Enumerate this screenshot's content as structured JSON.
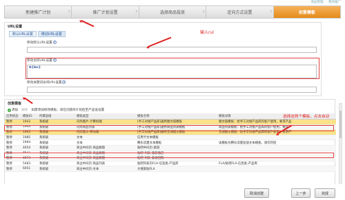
{
  "header": {
    "links": [
      "商品管理",
      "我的推广"
    ]
  },
  "steps": [
    {
      "label": "新建推广计划"
    },
    {
      "label": "推广计划设置"
    },
    {
      "label": "选择商品投放"
    },
    {
      "label": "定向方式设置"
    },
    {
      "label": "创意模板"
    }
  ],
  "url_panel": {
    "title": "URL设置",
    "tabs": [
      "默认URL设置",
      "移动URL设置"
    ],
    "field1_label": "移动默认URL设置",
    "field1_value": "",
    "field2_label": "移动访问URL设置",
    "field2_value": "${loc}",
    "field3_label": "移动关键词访问URL设置",
    "field3_value": "",
    "annotation": "输入rul"
  },
  "creative_panel": {
    "title": "创意模板",
    "toolbar": {
      "add": "添加",
      "delete": "删除",
      "hint": "如需添加修改模板，请在创建商计划后至产品设设置"
    },
    "annotation": "选择这两个模板，点击自动",
    "columns": [
      "启用状态",
      "模板ID",
      "所属层级",
      "模板类型",
      "模板名称",
      "模板详情"
    ],
    "rows": [
      [
        "暂停",
        "1943",
        "系统级",
        "闪烁图片-计算机端",
        "[手工对接产品库]通用图文链模板",
        "图文链模板：给手工对接产品库的客户使用，要求产品"
      ],
      [
        "暂停",
        "1944",
        "系统级",
        "闪烁商品列表",
        "[手工对接产品库]通用商品列表模板",
        "商品列表模板：给手工对接产品库的客户使用，要求产"
      ],
      [
        "暂停",
        "1965",
        "系统级",
        "闪烁图文-移动端",
        "[手工对接产品库]通用无线图文模板",
        "无线图文模板：给手工对接产品库的客户使用，要求产"
      ],
      [
        "暂停",
        "1985",
        "系统级",
        "文本",
        "信用卡文本模板",
        ""
      ],
      [
        "暂停",
        "1964",
        "系统级",
        "文本",
        "腾乐流量文本模板",
        "该模板为腾乐流量投放文本模板，请勿勿轻"
      ],
      [
        "暂停",
        "4654",
        "系统级",
        "商业中间页-商品橱窗",
        "贴吧中间页-旅游",
        ""
      ],
      [
        "暂停",
        "4671",
        "系统级",
        "商业中间页-商品橱窗",
        "贴吧-列表-旅游酒店",
        ""
      ],
      [
        "暂停",
        "4673",
        "系统级",
        "商业中间页-商品橱窗",
        "贴吧-列表-美食团购",
        ""
      ],
      [
        "暂停",
        "5483",
        "系统级",
        "商业中间页-商品列表",
        "贴吧列表页FLA-信息类-产品库",
        "FLA/贴吧FLA-信息类-产品库"
      ],
      [
        "暂停",
        "6051",
        "系统级",
        "商业中间页-文本",
        "大搜索贴FLA",
        ""
      ]
    ]
  },
  "footer": {
    "cancel": "取消创建",
    "prev": "上一步",
    "finish": "完成"
  }
}
